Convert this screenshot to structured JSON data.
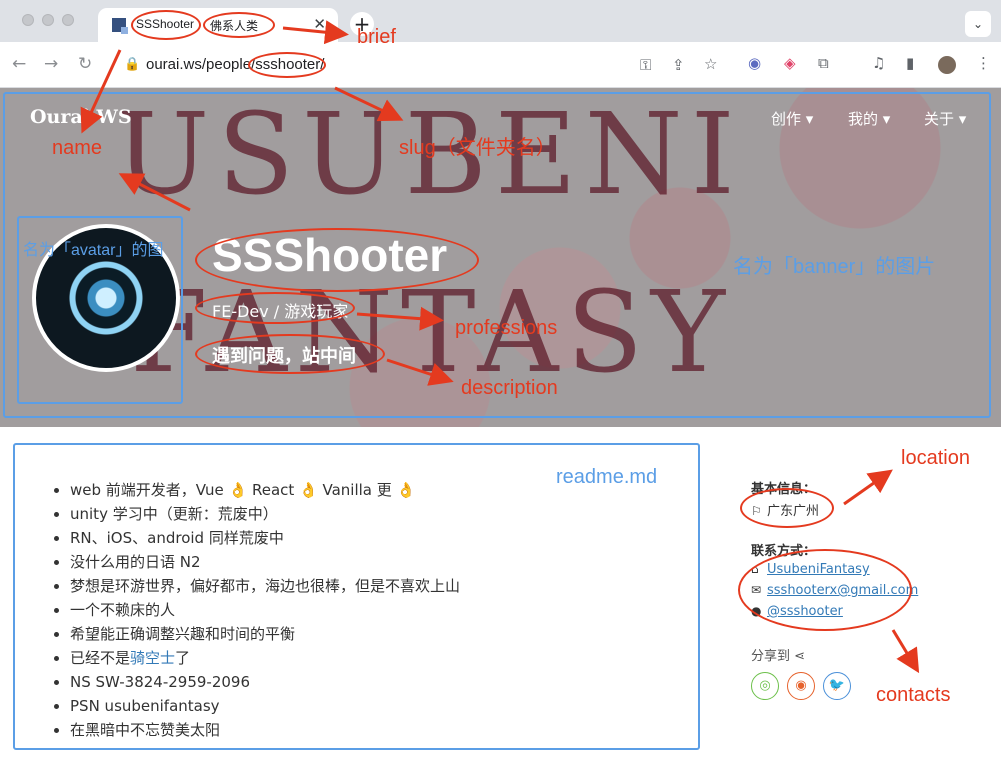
{
  "browser": {
    "tab_title": "SSShooter",
    "tab_brief": "佛系人类",
    "tab_close": "✕",
    "new_tab": "+",
    "url": "ourai.ws/people/ssshooter/"
  },
  "site": {
    "brand": "Ourai.WS",
    "menu": [
      {
        "label": "创作 ▾"
      },
      {
        "label": "我的 ▾"
      },
      {
        "label": "关于 ▾"
      }
    ],
    "banner_words": [
      "USUBENI",
      "FANTASY"
    ]
  },
  "profile": {
    "name": "SSShooter",
    "professions": "FE-Dev / 游戏玩家",
    "description": "遇到问题，站中间"
  },
  "readme": {
    "items": [
      {
        "text": "web 前端开发者，Vue 👌 React 👌 Vanilla 更 👌"
      },
      {
        "text": "unity 学习中（更新：荒废中）"
      },
      {
        "text": "RN、iOS、android 同样荒废中"
      },
      {
        "text": "没什么用的日语 N2"
      },
      {
        "text": "梦想是环游世界，偏好都市，海边也很棒，但是不喜欢上山"
      },
      {
        "text": "一个不赖床的人"
      },
      {
        "text": "希望能正确调整兴趣和时间的平衡"
      },
      {
        "prefix": "已经不是",
        "link": "骑空士",
        "suffix": "了"
      },
      {
        "text": "NS SW-3824-2959-2096"
      },
      {
        "text": "PSN usubenifantasy"
      },
      {
        "text": "在黑暗中不忘赞美太阳"
      }
    ]
  },
  "sidebar": {
    "basic_label": "基本信息：",
    "location": "广东广州",
    "contact_label": "联系方式：",
    "contacts": [
      {
        "icon": "home-icon",
        "text": "UsubeniFantasy"
      },
      {
        "icon": "envelope-icon",
        "text": "ssshooterx@gmail.com"
      },
      {
        "icon": "github-icon",
        "text": "@ssshooter"
      }
    ],
    "share_label": "分享到",
    "share_buttons": [
      {
        "icon": "wechat-icon",
        "color": "#6cc04a"
      },
      {
        "icon": "weibo-icon",
        "color": "#e6622c"
      },
      {
        "icon": "twitter-icon",
        "color": "#4a90d9"
      }
    ]
  },
  "annotations": {
    "brief": "brief",
    "name": "name",
    "slug": "slug（文件夹名）",
    "avatar": "名为「avatar」的图",
    "banner": "名为「banner」的图片",
    "professions": "professions",
    "description": "description",
    "readme": "readme.md",
    "location": "location",
    "contacts": "contacts"
  },
  "colors": {
    "annotation_red": "#e43a1f",
    "annotation_blue": "#5b9ee6",
    "link": "#337ab7"
  }
}
